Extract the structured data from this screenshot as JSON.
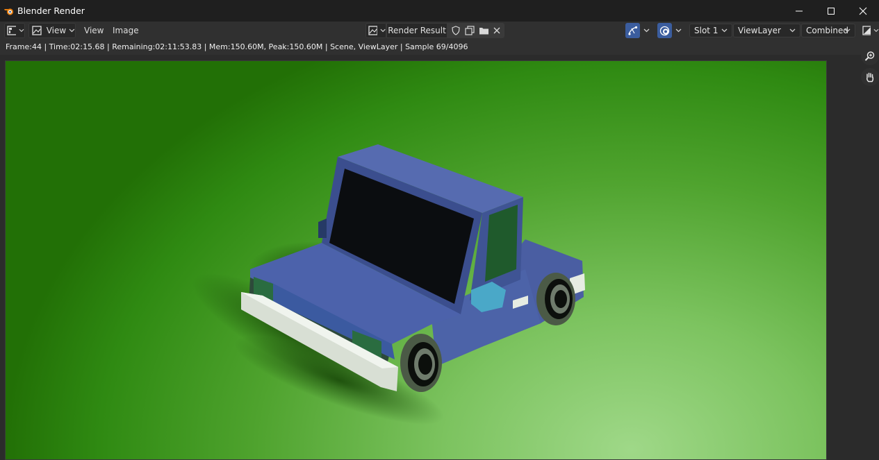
{
  "window": {
    "title": "Blender Render",
    "controls": {
      "minimize": "minimize-icon",
      "maximize": "maximize-icon",
      "close": "close-icon"
    }
  },
  "header": {
    "editor_type_icon": "image-editor-icon",
    "view_menu_icon": "image-view-icon",
    "view_dropdown_label": "View",
    "menus": [
      "View",
      "Image"
    ],
    "image_name": "Render Result",
    "image_icons": [
      "image-browse-icon",
      "fake-user-shield-icon",
      "duplicate-icon",
      "open-folder-icon",
      "unlink-close-icon"
    ],
    "gizmo_toggle_active": true,
    "overlay_toggle_active": true,
    "slot": "Slot 1",
    "view_layer": "ViewLayer",
    "pass": "Combined",
    "display_channels_icon": "display-channels-icon"
  },
  "status": {
    "text": "Frame:44 | Time:02:15.68 | Remaining:02:11:53.83 | Mem:150.60M, Peak:150.60M | Scene, ViewLayer | Sample 69/4096"
  },
  "tools": [
    "zoom-icon",
    "hand-pan-icon"
  ],
  "colors": {
    "accent": "#3b5d9e",
    "background_green": "#4fa32e",
    "car_body": "#4a5fa6"
  }
}
